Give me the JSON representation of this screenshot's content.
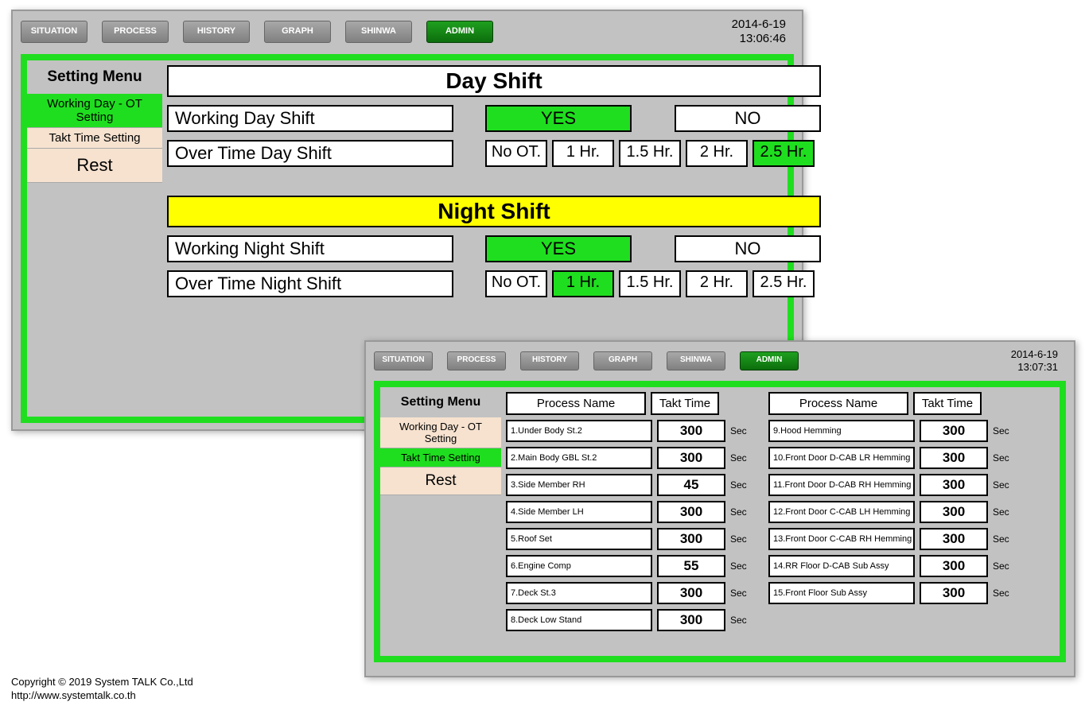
{
  "nav": [
    "SITUATION",
    "PROCESS",
    "HISTORY",
    "GRAPH",
    "SHINWA",
    "ADMIN"
  ],
  "nav_active_index": 5,
  "window1": {
    "date": "2014-6-19",
    "time": "13:06:46",
    "sidebar_title": "Setting Menu",
    "sidebar": [
      "Working Day - OT Setting",
      "Takt Time Setting",
      "Rest"
    ],
    "sidebar_selected": 0,
    "day_title": "Day Shift",
    "night_title": "Night Shift",
    "working_day_label": "Working Day Shift",
    "working_night_label": "Working Night Shift",
    "ot_day_label": "Over Time Day Shift",
    "ot_night_label": "Over Time Night Shift",
    "yes": "YES",
    "no": "NO",
    "ot_options": [
      "No OT.",
      "1 Hr.",
      "1.5 Hr.",
      "2 Hr.",
      "2.5 Hr."
    ],
    "day_working_sel": 0,
    "night_working_sel": 0,
    "day_ot_sel": 4,
    "night_ot_sel": 1
  },
  "window2": {
    "date": "2014-6-19",
    "time": "13:07:31",
    "sidebar_title": "Setting Menu",
    "sidebar": [
      "Working Day - OT Setting",
      "Takt Time Setting",
      "Rest"
    ],
    "sidebar_selected": 1,
    "pname_hdr": "Process Name",
    "tt_hdr": "Takt Time",
    "sec": "Sec",
    "left": [
      {
        "name": "1.Under Body St.2",
        "tt": "300"
      },
      {
        "name": "2.Main Body GBL St.2",
        "tt": "300"
      },
      {
        "name": "3.Side Member RH",
        "tt": "45"
      },
      {
        "name": "4.Side Member LH",
        "tt": "300"
      },
      {
        "name": "5.Roof Set",
        "tt": "300"
      },
      {
        "name": "6.Engine Comp",
        "tt": "55"
      },
      {
        "name": "7.Deck St.3",
        "tt": "300"
      },
      {
        "name": "8.Deck Low Stand",
        "tt": "300"
      }
    ],
    "right": [
      {
        "name": "9.Hood Hemming",
        "tt": "300"
      },
      {
        "name": "10.Front Door D-CAB LR Hemming",
        "tt": "300"
      },
      {
        "name": "11.Front Door D-CAB RH Hemming",
        "tt": "300"
      },
      {
        "name": "12.Front Door C-CAB LH Hemming",
        "tt": "300"
      },
      {
        "name": "13.Front Door C-CAB RH Hemming",
        "tt": "300"
      },
      {
        "name": "14.RR Floor D-CAB Sub Assy",
        "tt": "300"
      },
      {
        "name": "15.Front Floor Sub Assy",
        "tt": "300"
      }
    ]
  },
  "footer": {
    "line1": "Copyright © 2019 System TALK Co.,Ltd",
    "line2": "http://www.systemtalk.co.th"
  }
}
